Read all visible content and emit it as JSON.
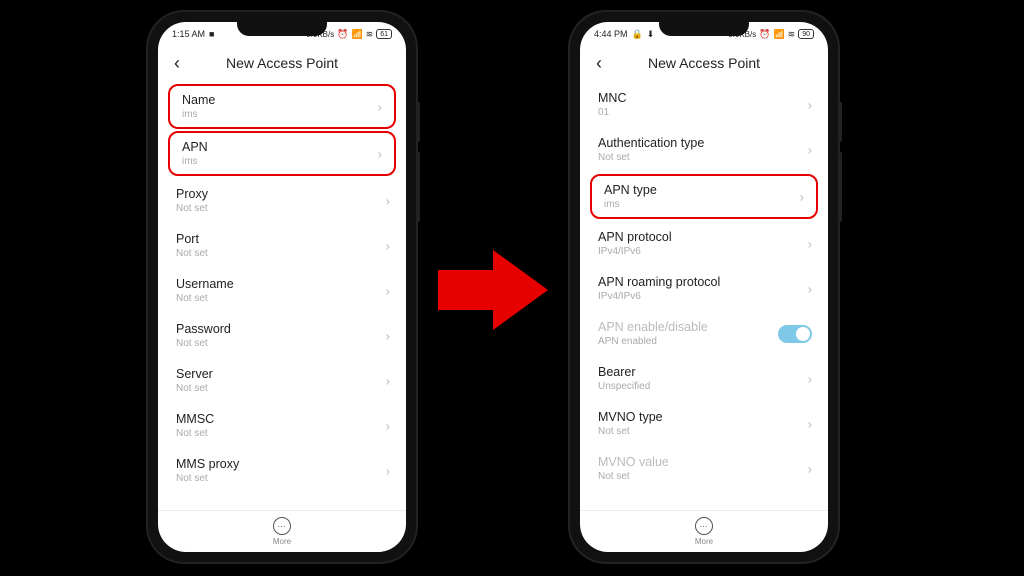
{
  "leftPhone": {
    "statusbar": {
      "time": "1:15 AM",
      "speed": "0.0KB/s",
      "battery": "61"
    },
    "title": "New Access Point",
    "rows": [
      {
        "label": "Name",
        "value": "ims",
        "hl": true
      },
      {
        "label": "APN",
        "value": "ims",
        "hl": true
      },
      {
        "label": "Proxy",
        "value": "Not set"
      },
      {
        "label": "Port",
        "value": "Not set"
      },
      {
        "label": "Username",
        "value": "Not set"
      },
      {
        "label": "Password",
        "value": "Not set"
      },
      {
        "label": "Server",
        "value": "Not set"
      },
      {
        "label": "MMSC",
        "value": "Not set"
      },
      {
        "label": "MMS proxy",
        "value": "Not set"
      }
    ],
    "more": "More"
  },
  "rightPhone": {
    "statusbar": {
      "time": "4:44 PM",
      "speed": "0.0KB/s",
      "battery": "90"
    },
    "title": "New Access Point",
    "rows": [
      {
        "label": "MNC",
        "value": "01"
      },
      {
        "label": "Authentication type",
        "value": "Not set"
      },
      {
        "label": "APN type",
        "value": "ims",
        "hl": true
      },
      {
        "label": "APN protocol",
        "value": "IPv4/IPv6"
      },
      {
        "label": "APN roaming protocol",
        "value": "IPv4/IPv6"
      },
      {
        "label": "APN enable/disable",
        "value": "APN enabled",
        "dim": true,
        "toggle": true
      },
      {
        "label": "Bearer",
        "value": "Unspecified"
      },
      {
        "label": "MVNO type",
        "value": "Not set"
      },
      {
        "label": "MVNO value",
        "value": "Not set",
        "dim": true
      }
    ],
    "more": "More"
  }
}
